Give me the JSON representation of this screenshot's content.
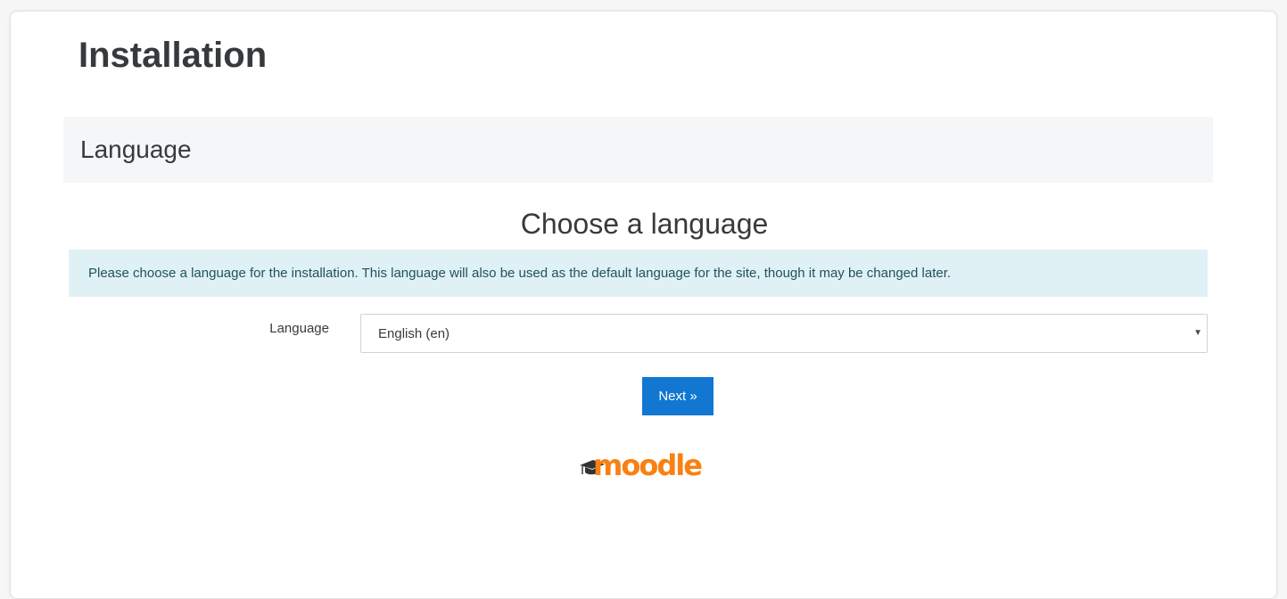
{
  "page": {
    "title": "Installation"
  },
  "section": {
    "title": "Language"
  },
  "form": {
    "heading": "Choose a language",
    "info": "Please choose a language for the installation. This language will also be used as the default language for the site, though it may be changed later.",
    "language_label": "Language",
    "language_value": "English (en)",
    "next_label": "Next »"
  },
  "logo": {
    "text": "moodle",
    "icon": "graduation-cap-icon"
  },
  "colors": {
    "accent": "#1177d1",
    "info_bg": "#dff1f5",
    "info_text": "#22515e",
    "brand_orange": "#f98012",
    "brand_cap": "#333333"
  }
}
